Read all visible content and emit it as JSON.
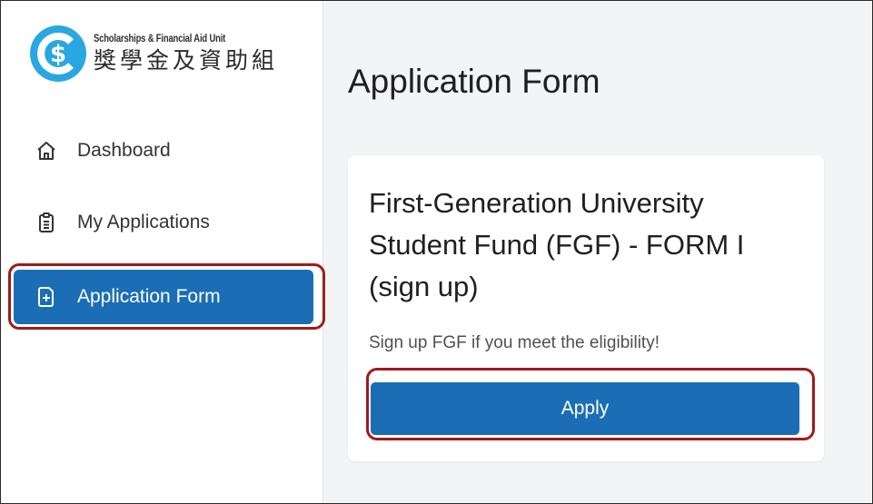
{
  "logo": {
    "name_en": "Scholarships & Financial Aid Unit",
    "name_zh": "獎學金及資助組",
    "icon": "sfau-logo-icon",
    "color": "#2aa7e0"
  },
  "sidebar": {
    "items": [
      {
        "label": "Dashboard",
        "icon": "home-icon",
        "active": false
      },
      {
        "label": "My Applications",
        "icon": "clipboard-list-icon",
        "active": false
      },
      {
        "label": "Application Form",
        "icon": "file-plus-icon",
        "active": true
      }
    ]
  },
  "main": {
    "title": "Application Form",
    "card": {
      "title": "First-Generation University Student Fund (FGF) - FORM I (sign up)",
      "description": "Sign up FGF if you meet the eligibility!",
      "button_label": "Apply"
    }
  },
  "colors": {
    "primary": "#1b6eb5",
    "highlight_outline": "#a11a1a",
    "main_bg": "#f3f4f6"
  }
}
